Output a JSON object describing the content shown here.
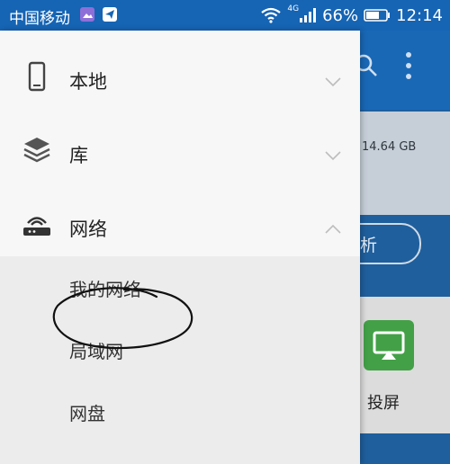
{
  "status_bar": {
    "carrier": "中国移动",
    "network_type": "4G",
    "battery_percent": "66%",
    "time": "12:14"
  },
  "background_app": {
    "storage_text": "14.64 GB",
    "pill_text": "析",
    "cast_label": "投屏"
  },
  "drawer": {
    "items": [
      {
        "label": "本地",
        "icon": "phone-icon",
        "expanded": false
      },
      {
        "label": "库",
        "icon": "layers-icon",
        "expanded": false
      },
      {
        "label": "网络",
        "icon": "router-icon",
        "expanded": true
      }
    ],
    "network_subitems": [
      {
        "label": "我的网络"
      },
      {
        "label": "局域网",
        "annotated": true
      },
      {
        "label": "网盘"
      }
    ]
  },
  "colors": {
    "status_bar": "#1664b4",
    "drawer_bg": "#f7f7f7",
    "submenu_bg": "#ececec",
    "annotation": "#111111"
  }
}
